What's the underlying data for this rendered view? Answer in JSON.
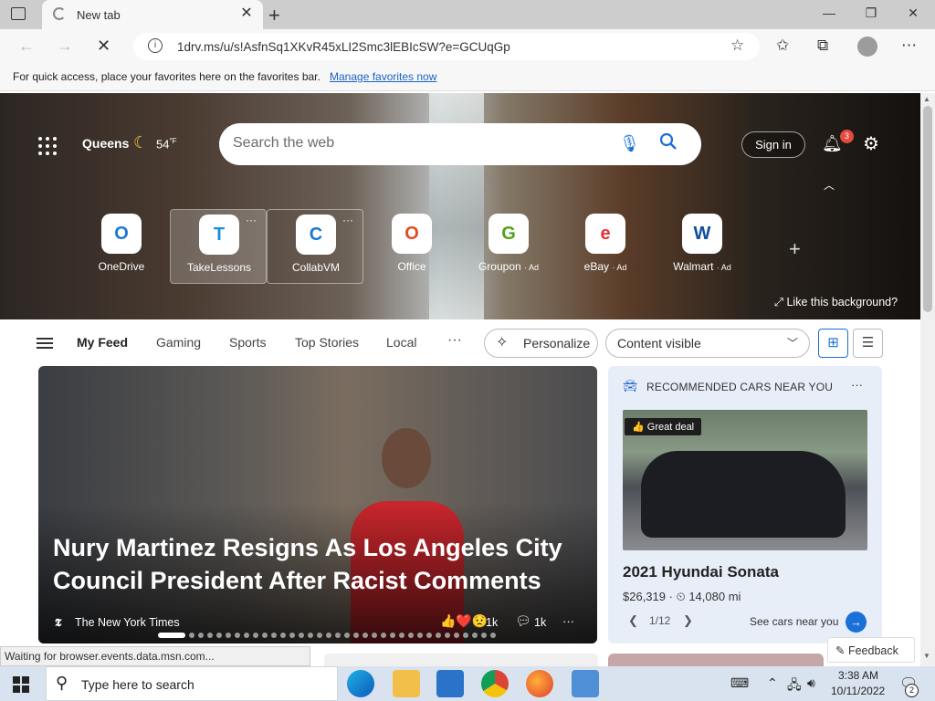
{
  "browser": {
    "tab_title": "New tab",
    "url": "1drv.ms/u/s!AsfnSq1XKvR45xLI2Smc3lEBIcSW?e=GCUqGp",
    "favorites_message": "For quick access, place your favorites here on the favorites bar.",
    "favorites_link": "Manage favorites now",
    "status_text": "Waiting for browser.events.data.msn.com..."
  },
  "hero": {
    "city": "Queens",
    "temperature": "54",
    "unit": "°F",
    "search_placeholder": "Search the web",
    "signin_label": "Sign in",
    "notification_count": "3",
    "like_background": "Like this background?",
    "tiles": [
      {
        "label": "OneDrive",
        "icon": "onedrive-icon",
        "color": "#1a78d4"
      },
      {
        "label": "TakeLessons",
        "icon": "takelessons-icon",
        "color": "#1a8fd8"
      },
      {
        "label": "CollabVM",
        "icon": "collabvm-icon",
        "color": "#1a78d4"
      },
      {
        "label": "Office",
        "icon": "office-icon",
        "color": "#e34a26"
      },
      {
        "label": "Groupon",
        "ad": "· Ad",
        "icon": "groupon-icon",
        "color": "#53a318"
      },
      {
        "label": "eBay",
        "ad": "· Ad",
        "icon": "ebay-icon",
        "color": "#e53238"
      },
      {
        "label": "Walmart",
        "ad": "· Ad",
        "icon": "walmart-icon",
        "color": "#0f4da0"
      }
    ]
  },
  "feed_nav": {
    "tabs": [
      "My Feed",
      "Gaming",
      "Sports",
      "Top Stories",
      "Local"
    ],
    "more": "···",
    "personalize": "Personalize",
    "content_visibility": "Content visible"
  },
  "main_story": {
    "headline": "Nury Martinez Resigns As Los Angeles City Council President After Racist Comments",
    "source_logo": "𝕿",
    "source": "The New York Times",
    "reaction_count": "1k",
    "comment_count": "1k",
    "pager_total": 35,
    "pager_active": 0
  },
  "cars_card": {
    "title": "RECOMMENDED CARS NEAR YOU",
    "badge": "Great deal",
    "car_name": "2021 Hyundai Sonata",
    "price": "$26,319",
    "mileage": "14,080 mi",
    "page": "1/12",
    "cta": "See cars near you"
  },
  "feedback": "Feedback",
  "taskbar": {
    "search_placeholder": "Type here to search",
    "time": "3:38 AM",
    "date": "10/11/2022",
    "notification_count": "2"
  }
}
